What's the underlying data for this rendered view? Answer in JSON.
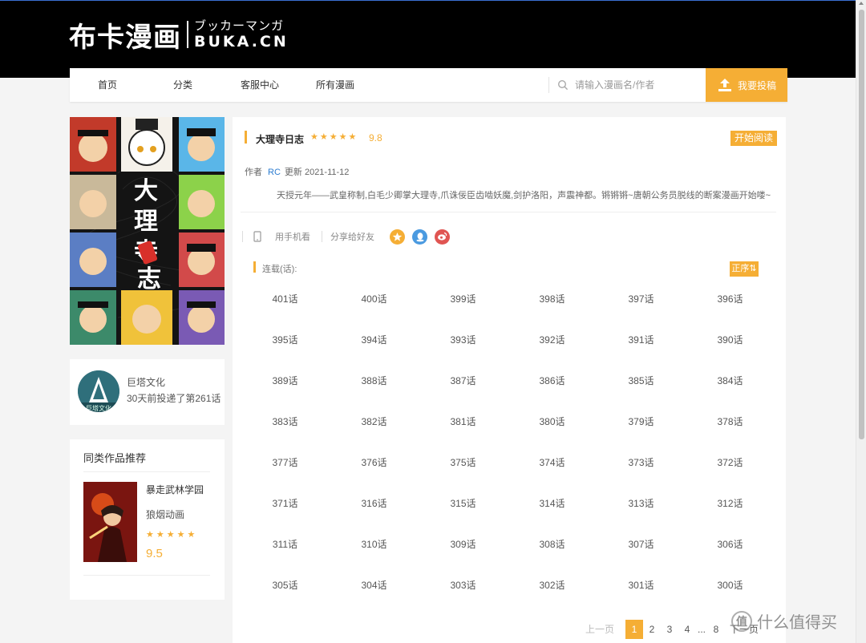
{
  "header": {
    "logo_cn": "布卡漫画",
    "logo_kana": "ブッカーマンガ",
    "logo_en": "BUKA.CN"
  },
  "nav": {
    "items": [
      {
        "label": "首页"
      },
      {
        "label": "分类"
      },
      {
        "label": "客服中心"
      },
      {
        "label": "所有漫画"
      }
    ],
    "search_placeholder": "请输入漫画名/作者",
    "upload_label": "我要投稿"
  },
  "cover": {
    "title_chars": [
      "大",
      "理",
      "寺",
      "志"
    ]
  },
  "author_card": {
    "name": "巨塔文化",
    "update_text": "30天前投递了第261话",
    "avatar_text": "巨塔文化"
  },
  "recommend": {
    "heading": "同类作品推荐",
    "item": {
      "title": "暴走武林学园",
      "author": "狼烟动画",
      "stars": "★★★★★",
      "score": "9.5"
    }
  },
  "comic": {
    "title": "大理寺日志",
    "stars": "★★★★★",
    "score": "9.8",
    "read_button": "开始阅读",
    "author_label": "作者",
    "author": "RC",
    "update_label": "更新",
    "update_date": "2021-11-12",
    "description": "天授元年——武皇称制,白毛少卿掌大理寺,爪诛佞臣齿啮妖魔,剑护洛阳，声震神都。锵锵锵~唐朝公务员脱线的断案漫画开始喽~",
    "mobile_label": "用手机看",
    "share_label": "分享给好友",
    "serial_label": "连载(话):",
    "sort_button": "正序⇅",
    "episodes": [
      "401话",
      "400话",
      "399话",
      "398话",
      "397话",
      "396话",
      "395话",
      "394话",
      "393话",
      "392话",
      "391话",
      "390话",
      "389话",
      "388话",
      "387话",
      "386话",
      "385话",
      "384话",
      "383话",
      "382话",
      "381话",
      "380话",
      "379话",
      "378话",
      "377话",
      "376话",
      "375话",
      "374话",
      "373话",
      "372话",
      "371话",
      "316话",
      "315话",
      "314话",
      "313话",
      "312话",
      "311话",
      "310话",
      "309话",
      "308话",
      "307话",
      "306话",
      "305话",
      "304话",
      "303话",
      "302话",
      "301话",
      "300话"
    ]
  },
  "pager": {
    "prev": "上一页",
    "pages": [
      "1",
      "2",
      "3",
      "4"
    ],
    "ellipsis": "...",
    "last": "8",
    "next": "下一页"
  },
  "watermark": {
    "icon_text": "值",
    "text": "什么值得买"
  },
  "colors": {
    "accent": "#f5ae35",
    "link": "#2b7bd0",
    "header_bg": "#000000",
    "page_bg": "#f4f4f4"
  }
}
